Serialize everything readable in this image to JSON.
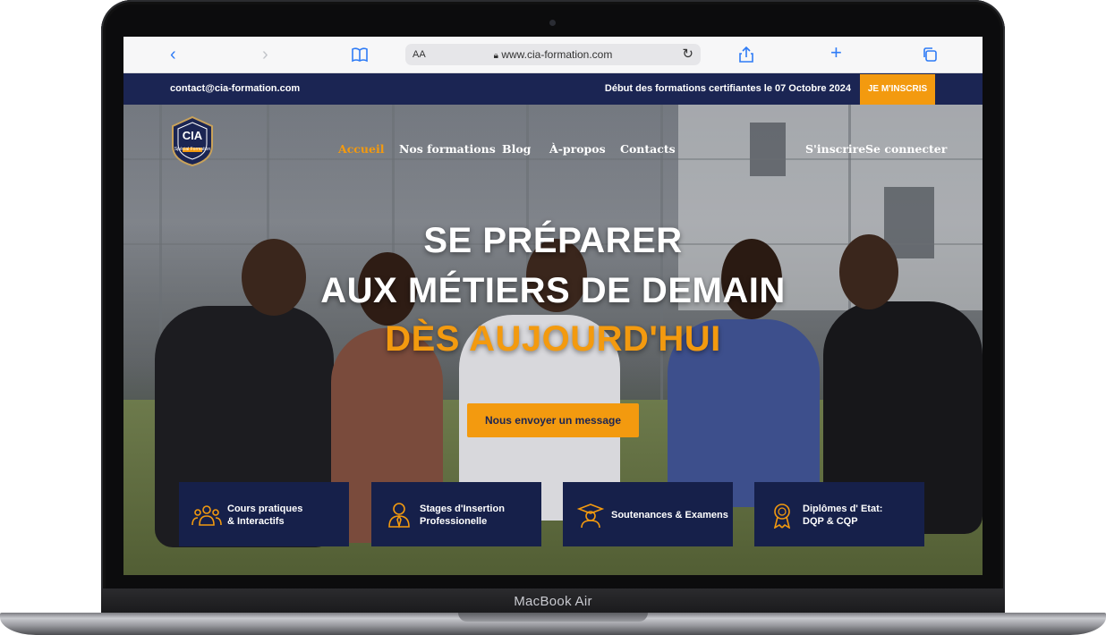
{
  "device": {
    "label": "MacBook Air"
  },
  "browser": {
    "text_size_label": "AA",
    "url": "www.cia-formation.com",
    "icons": [
      "back-arrow-icon",
      "forward-arrow-icon",
      "bookmarks-book-icon",
      "lock-icon",
      "reload-icon",
      "share-icon",
      "new-tab-plus-icon",
      "tabs-overview-icon"
    ]
  },
  "top_strip": {
    "email": "contact@cia-formation.com",
    "notice": "Début des formations certifiantes le 07 Octobre 2024",
    "cta": "JE M'INSCRIS"
  },
  "logo": {
    "letters": "CIA",
    "subtitle": "Spécial Formation"
  },
  "nav": {
    "items": [
      {
        "label": "Accueil",
        "active": true
      },
      {
        "label": "Nos formations"
      },
      {
        "label": "Blog"
      },
      {
        "label": "À-propos"
      },
      {
        "label": "Contacts"
      }
    ],
    "signup": "S'inscrire",
    "login": "Se connecter"
  },
  "hero": {
    "line1": "SE PRÉPARER",
    "line2": "AUX MÉTIERS DE DEMAIN",
    "line3": "DÈS AUJOURD'HUI",
    "button": "Nous envoyer un message"
  },
  "cards": [
    {
      "text": "Cours pratiques\n& Interactifs",
      "icon": "group-people-icon"
    },
    {
      "text": "Stages d'Insertion\nProfessionelle",
      "icon": "professional-person-icon"
    },
    {
      "text": "Soutenances & Examens",
      "icon": "graduate-cap-icon"
    },
    {
      "text": "Diplômes d' Etat:\nDQP & CQP",
      "icon": "award-medal-icon"
    }
  ],
  "colors": {
    "navy": "#1b2553",
    "accent": "#f39a0f",
    "card": "#16204a"
  }
}
